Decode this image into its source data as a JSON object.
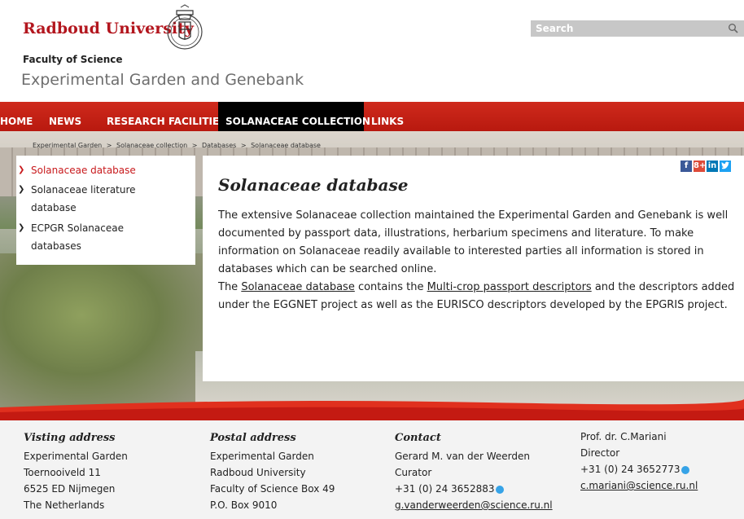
{
  "header": {
    "logo_text": "Radboud University",
    "faculty": "Faculty of Science",
    "department": "Experimental Garden and Genebank",
    "search_placeholder": "Search"
  },
  "nav": {
    "items": [
      {
        "label": "HOME"
      },
      {
        "label": "NEWS"
      },
      {
        "label": "RESEARCH FACILITIES"
      },
      {
        "label": "SOLANACEAE COLLECTION",
        "active": true
      },
      {
        "label": "LINKS"
      }
    ]
  },
  "breadcrumb": [
    "Experimental Garden",
    ">",
    "Solanaceae collection",
    ">",
    "Databases",
    ">",
    "Solanaceae database"
  ],
  "sidenav": {
    "items": [
      {
        "label": "Solanaceae database",
        "active": true
      },
      {
        "label_line1": "Solanaceae literature",
        "label_line2": "database"
      },
      {
        "label_line1": "ECPGR Solanaceae",
        "label_line2": "databases"
      }
    ]
  },
  "content": {
    "title": "Solanaceae database",
    "para1": "The extensive Solanaceae collection maintained the Experimental Garden and Genebank is well documented by passport data, illustrations, herbarium specimens and literature. To make information on Solanaceae readily available to interested parties all information is stored in databases which can be searched online.",
    "para2_prefix": "The ",
    "para2_link1": "Solanaceae database",
    "para2_mid": " contains the ",
    "para2_link2": "Multi-crop passport descriptors",
    "para2_suffix": " and the descriptors added under the EGGNET project as well as the EURISCO descriptors developed by the EPGRIS project."
  },
  "share": {
    "facebook": "f",
    "googleplus": "8+",
    "linkedin": "in"
  },
  "footer": {
    "visiting": {
      "heading": "Visting address",
      "lines": [
        "Experimental Garden",
        "Toernooiveld 11",
        "6525 ED Nijmegen",
        "The Netherlands"
      ]
    },
    "postal": {
      "heading": "Postal address",
      "lines": [
        "Experimental Garden",
        "Radboud University",
        "Faculty of Science Box 49",
        "P.O. Box 9010"
      ]
    },
    "contact": {
      "heading": "Contact",
      "name": "Gerard M. van der Weerden",
      "role": "Curator",
      "phone": "+31 (0) 24 3652883",
      "email": "g.vanderweerden@science.ru.nl"
    },
    "director": {
      "name": "Prof. dr. C.Mariani",
      "role": "Director",
      "phone": "+31 (0) 24 3652773",
      "email": "c.mariani@science.ru.nl"
    }
  },
  "colors": {
    "brand_red": "#b3161e",
    "nav_red": "#c62216",
    "active_black": "#000000",
    "link_red": "#c8191c"
  }
}
